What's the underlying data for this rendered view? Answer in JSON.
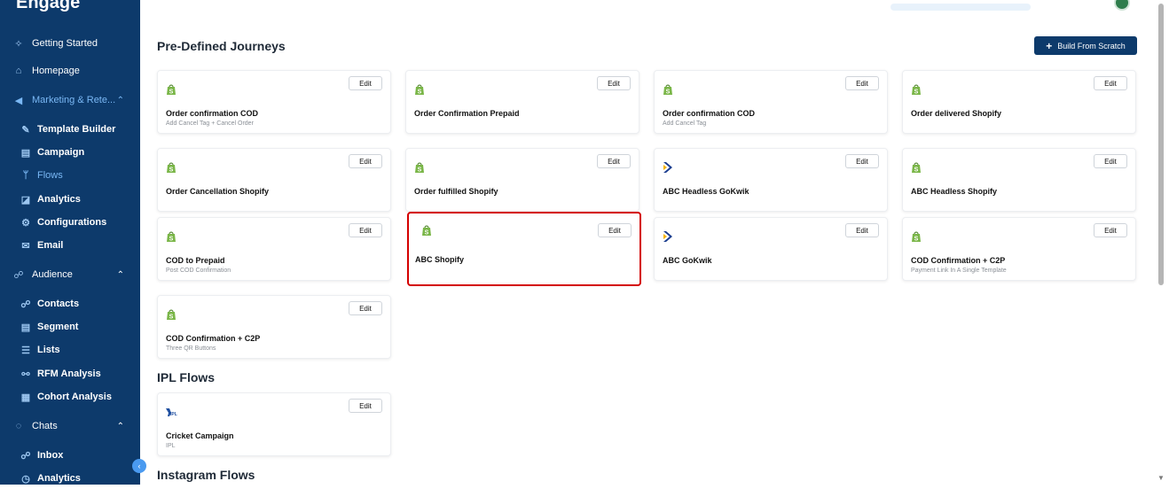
{
  "app": {
    "logo_text": "Engage"
  },
  "sidebar": {
    "items": [
      {
        "label": "Getting Started",
        "icon": "sparkle-icon"
      },
      {
        "label": "Homepage",
        "icon": "home-icon"
      },
      {
        "label": "Marketing & Rete...",
        "icon": "megaphone-icon",
        "expanded": true
      },
      {
        "label": "Template Builder",
        "icon": "brush-icon"
      },
      {
        "label": "Campaign",
        "icon": "document-icon"
      },
      {
        "label": "Flows",
        "icon": "flow-icon",
        "active": true
      },
      {
        "label": "Analytics",
        "icon": "chart-icon"
      },
      {
        "label": "Configurations",
        "icon": "config-icon"
      },
      {
        "label": "Email",
        "icon": "mail-icon"
      },
      {
        "label": "Audience",
        "icon": "audience-icon",
        "expanded": true
      },
      {
        "label": "Contacts",
        "icon": "contacts-icon"
      },
      {
        "label": "Segment",
        "icon": "segment-icon"
      },
      {
        "label": "Lists",
        "icon": "list-icon"
      },
      {
        "label": "RFM Analysis",
        "icon": "rfm-icon"
      },
      {
        "label": "Cohort Analysis",
        "icon": "cohort-icon"
      },
      {
        "label": "Chats",
        "icon": "chat-icon",
        "expanded": true
      },
      {
        "label": "Inbox",
        "icon": "inbox-icon"
      },
      {
        "label": "Analytics",
        "icon": "clock-icon"
      }
    ]
  },
  "header": {
    "build_button": "Build From Scratch"
  },
  "sections": {
    "predefined": "Pre-Defined Journeys",
    "ipl": "IPL Flows",
    "instagram": "Instagram Flows"
  },
  "edit_label": "Edit",
  "cards": [
    {
      "title": "Order confirmation COD",
      "sub": "Add Cancel Tag + Cancel Order",
      "logo": "shopify"
    },
    {
      "title": "Order Confirmation Prepaid",
      "sub": "",
      "logo": "shopify"
    },
    {
      "title": "Order confirmation COD",
      "sub": "Add Cancel Tag",
      "logo": "shopify"
    },
    {
      "title": "Order delivered Shopify",
      "sub": "",
      "logo": "shopify"
    },
    {
      "title": "Order Cancellation Shopify",
      "sub": "",
      "logo": "shopify"
    },
    {
      "title": "Order fulfilled Shopify",
      "sub": "",
      "logo": "shopify"
    },
    {
      "title": "ABC Headless GoKwik",
      "sub": "",
      "logo": "gokwik"
    },
    {
      "title": "ABC Headless Shopify",
      "sub": "",
      "logo": "shopify"
    },
    {
      "title": "COD to Prepaid",
      "sub": "Post COD Confirmation",
      "logo": "shopify"
    },
    {
      "title": "ABC Shopify",
      "sub": "",
      "logo": "shopify",
      "highlighted": true
    },
    {
      "title": "ABC GoKwik",
      "sub": "",
      "logo": "gokwik"
    },
    {
      "title": "COD Confirmation + C2P",
      "sub": "Payment Link In A Single Template",
      "logo": "shopify"
    },
    {
      "title": "COD Confirmation + C2P",
      "sub": "Three QR Buttons",
      "logo": "shopify"
    },
    {
      "title": "Cricket Campaign",
      "sub": "IPL",
      "logo": "ipl"
    }
  ],
  "colors": {
    "sidebar": "#0d3a6b",
    "accent": "#4a9af0",
    "shopify": "#5e8e3e",
    "highlight": "#d40000"
  }
}
